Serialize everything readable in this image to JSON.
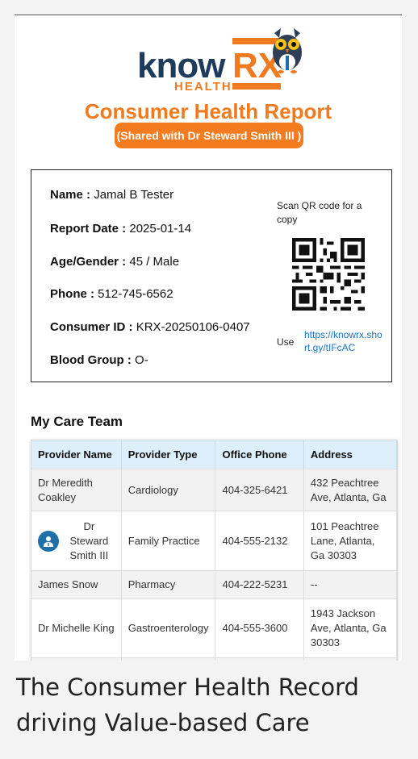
{
  "logo": {
    "text_main": "know",
    "text_rx": "RX",
    "text_sub": "HEALTH"
  },
  "report": {
    "title": "Consumer Health Report",
    "shared_with": "(Shared with Dr Steward Smith III )"
  },
  "patient": {
    "name_label": "Name :",
    "name_value": "Jamal B Tester",
    "report_date_label": "Report Date :",
    "report_date_value": "2025-01-14",
    "age_gender_label": "Age/Gender :",
    "age_gender_value": "45 / Male",
    "phone_label": "Phone :",
    "phone_value": "512-745-6562",
    "consumer_id_label": "Consumer ID :",
    "consumer_id_value": "KRX-20250106-0407",
    "blood_group_label": "Blood Group :",
    "blood_group_value": "O-"
  },
  "qr": {
    "caption": "Scan QR code for a copy",
    "use_label": "Use",
    "link": "https://knowrx.short.gy/tIFcAC"
  },
  "care_team": {
    "title": "My Care Team",
    "headers": [
      "Provider Name",
      "Provider Type",
      "Office Phone",
      "Address"
    ],
    "rows": [
      [
        "Dr Meredith Coakley",
        "Cardiology",
        "404-325-6421",
        "432 Peachtree Ave, Atlanta, Ga"
      ],
      [
        "Dr Steward Smith III",
        "Family Practice",
        "404-555-2132",
        "101 Peachtree Lane, Atlanta, Ga 30303"
      ],
      [
        "James Snow",
        "Pharmacy",
        "404-222-5231",
        "--"
      ],
      [
        "Dr Michelle King",
        "Gastroenterology",
        "404-555-3600",
        "1943 Jackson Ave, Atlanta, Ga 30303"
      ],
      [
        "",
        "",
        "",
        ""
      ]
    ]
  },
  "caption": "The Consumer Health Record driving Value-based Care",
  "colors": {
    "accent": "#f47b20",
    "brand_dark": "#1f3b5c",
    "link": "#1a73c7",
    "table_header": "#dceffa"
  }
}
